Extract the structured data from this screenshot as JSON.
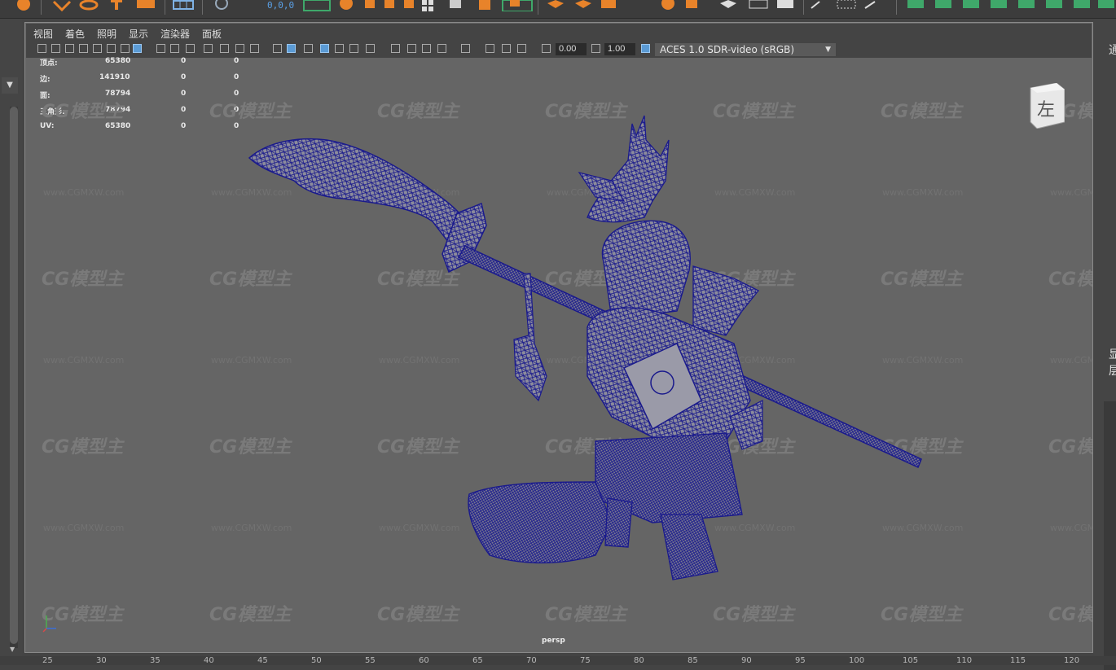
{
  "shelf": {
    "coord_readout": "0,0,0",
    "icons": [
      "shelf-tool-icon",
      "select-icon",
      "lasso-icon",
      "transform-icon",
      "cube-icon",
      "grid-icon",
      "snap-icon",
      "render-icon",
      "sphere-icon",
      "uv-icon",
      "layout-icon"
    ],
    "accent_orange": "#e8832a",
    "accent_green": "#3fa86a"
  },
  "panel_menu": [
    "视图",
    "着色",
    "照明",
    "显示",
    "渲染器",
    "面板"
  ],
  "toolbar": {
    "field1": "0.00",
    "field2": "1.00",
    "color_space": "ACES 1.0 SDR-video (sRGB)"
  },
  "hud": {
    "rows": [
      {
        "label": "顶点:",
        "v1": "65380",
        "v2": "0",
        "v3": "0"
      },
      {
        "label": "边:",
        "v1": "141910",
        "v2": "0",
        "v3": "0"
      },
      {
        "label": "面:",
        "v1": "78794",
        "v2": "0",
        "v3": "0"
      },
      {
        "label": "三角形:",
        "v1": "78794",
        "v2": "0",
        "v3": "0"
      },
      {
        "label": "UV:",
        "v1": "65380",
        "v2": "0",
        "v3": "0"
      }
    ]
  },
  "view_cube": {
    "label": "左"
  },
  "camera_label": "persp",
  "watermark": {
    "logo": "CG模型主",
    "url": "www.CGMXW.com"
  },
  "right_panel_chars": [
    "通",
    "显",
    "层"
  ],
  "ruler_ticks": [
    "25",
    "30",
    "35",
    "40",
    "45",
    "50",
    "55",
    "60",
    "65",
    "70",
    "75",
    "80",
    "85",
    "90",
    "95",
    "100",
    "105",
    "110",
    "115",
    "120"
  ],
  "colors": {
    "viewport_bg": "#656565",
    "wireframe": "#1a1a8c",
    "mesh_fill": "#8a8a9a",
    "panel_bg": "#444444"
  }
}
